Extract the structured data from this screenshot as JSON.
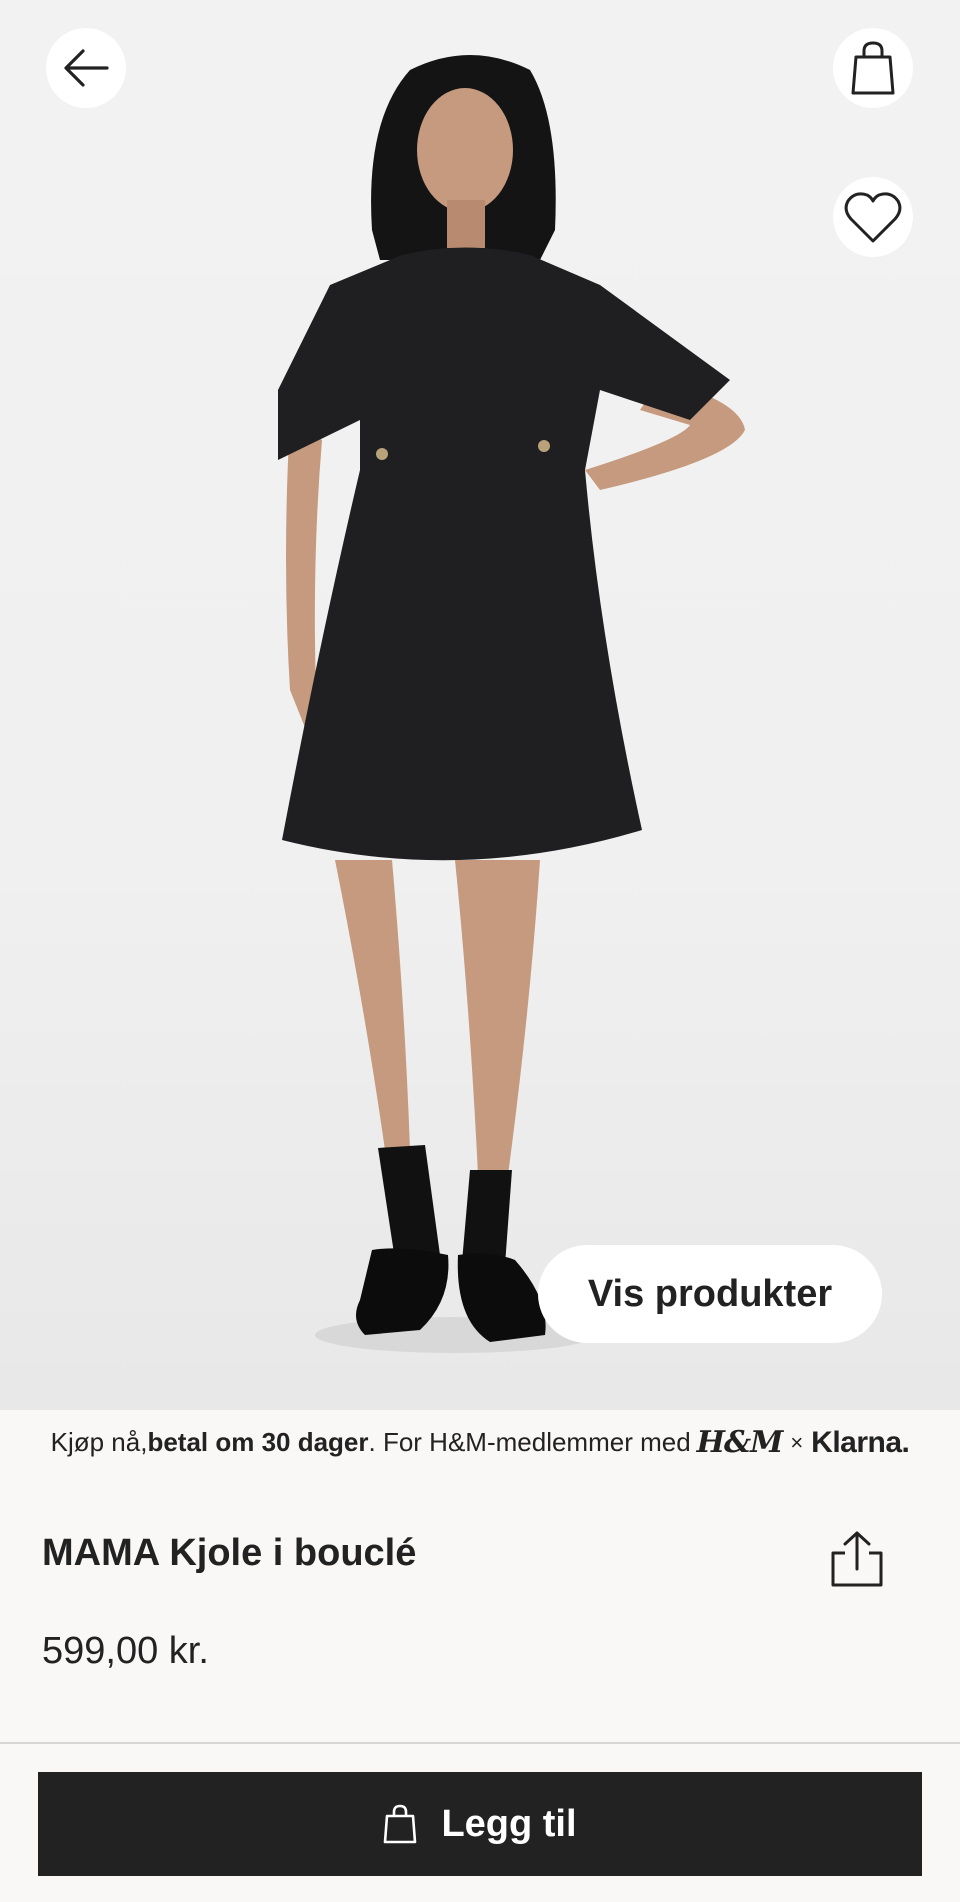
{
  "header": {
    "back_icon": "arrow-left-icon",
    "bag_icon": "shopping-bag-icon",
    "favorite_icon": "heart-icon"
  },
  "hero": {
    "image_icon": "model-black-boucle-dress-photo",
    "show_products_label": "Vis produkter"
  },
  "klarna_banner": {
    "part1": "Kjøp nå, ",
    "bold": "betal om 30 dager",
    "part2": ". For H&M-medlemmer med ",
    "hm_logo": "H&M",
    "times": "×",
    "klarna_logo": "Klarna."
  },
  "product": {
    "title": "MAMA Kjole i bouclé",
    "price": "599,00 kr.",
    "share_icon": "share-icon"
  },
  "footer": {
    "add_label": "Legg til",
    "add_icon": "shopping-bag-icon"
  },
  "colors": {
    "button_dark": "#222222",
    "page_bg": "#f9f8f6"
  }
}
